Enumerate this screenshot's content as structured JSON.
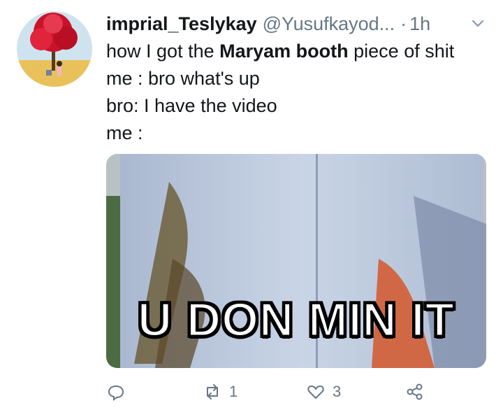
{
  "tweet": {
    "display_name": "imprial_Teslykay",
    "handle": "@Yusufkayod...",
    "separator": "·",
    "time": "1h",
    "text_lines": [
      {
        "pre": "how I got the ",
        "bold": "Maryam booth",
        "post": " piece of shit"
      },
      {
        "pre": "me : bro what's up",
        "bold": "",
        "post": ""
      },
      {
        "pre": "bro: I have the video",
        "bold": "",
        "post": ""
      },
      {
        "pre": "me :",
        "bold": "",
        "post": ""
      }
    ],
    "media_caption": "U DON MIN IT",
    "actions": {
      "reply_count": "",
      "retweet_count": "1",
      "like_count": "3"
    }
  },
  "colors": {
    "text": "#14171a",
    "secondary": "#657786"
  },
  "icons": [
    "chevron-down-icon",
    "reply-icon",
    "retweet-icon",
    "like-icon",
    "share-icon"
  ]
}
